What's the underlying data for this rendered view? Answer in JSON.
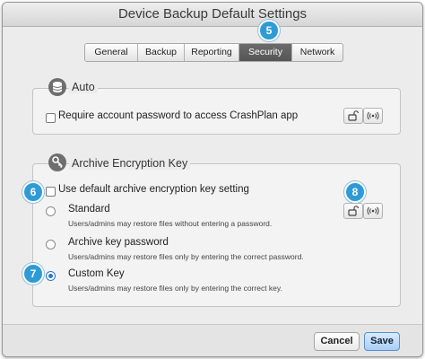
{
  "window": {
    "title": "Device Backup Default Settings"
  },
  "tabs": [
    {
      "label": "General"
    },
    {
      "label": "Backup"
    },
    {
      "label": "Reporting"
    },
    {
      "label": "Security"
    },
    {
      "label": "Network"
    }
  ],
  "active_tab": "Security",
  "callouts": {
    "tab_marker": "5",
    "checkbox_marker": "6",
    "radio_marker": "7",
    "lock_marker": "8"
  },
  "auto": {
    "title": "Auto",
    "require_password_label": "Require account password to access CrashPlan app"
  },
  "encryption": {
    "title": "Archive Encryption Key",
    "use_default_label": "Use default archive encryption key setting",
    "options": [
      {
        "label": "Standard",
        "description": "Users/admins may restore files without entering a password.",
        "selected": false
      },
      {
        "label": "Archive key password",
        "description": "Users/admins may restore files only by entering the correct password.",
        "selected": false
      },
      {
        "label": "Custom Key",
        "description": "Users/admins may restore files only by entering the correct key.",
        "selected": true
      }
    ]
  },
  "buttons": {
    "cancel": "Cancel",
    "save": "Save"
  },
  "colors": {
    "callout": "#2f9bd6",
    "active_tab": "#5e5e5e",
    "radio_selected": "#2c76c9",
    "save_button": "#a9cdf5"
  },
  "icons": [
    "database-icon",
    "key-icon",
    "lock-open-icon",
    "broadcast-icon"
  ]
}
